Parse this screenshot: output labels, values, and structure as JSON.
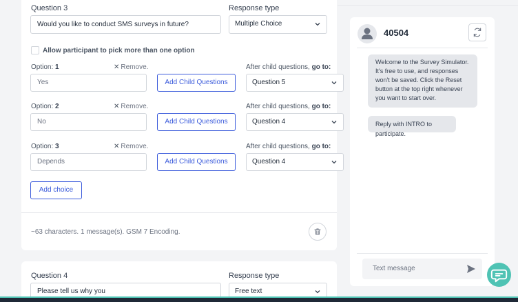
{
  "question3": {
    "label": "Question 3",
    "text": "Would you like to conduct SMS surveys in future?",
    "response_type_label": "Response type",
    "response_type": "Multiple Choice",
    "multi_option_label": "Allow participant to pick more than one option",
    "options": [
      {
        "prefix": "Option:",
        "num": "1",
        "remove": "Remove.",
        "placeholder": "Yes",
        "add_child": "Add Child Questions",
        "goto_label": "After child questions,",
        "goto_bold": "go to:",
        "goto": "Question 5"
      },
      {
        "prefix": "Option:",
        "num": "2",
        "remove": "Remove.",
        "placeholder": "No",
        "add_child": "Add Child Questions",
        "goto_label": "After child questions,",
        "goto_bold": "go to:",
        "goto": "Question 4"
      },
      {
        "prefix": "Option:",
        "num": "3",
        "remove": "Remove.",
        "placeholder": "Depends",
        "add_child": "Add Child Questions",
        "goto_label": "After child questions,",
        "goto_bold": "go to:",
        "goto": "Question 4"
      }
    ],
    "add_choice": "Add choice",
    "char_info": "~63 characters. 1 message(s). GSM 7 Encoding."
  },
  "question4": {
    "label": "Question 4",
    "text": "Please tell us why you",
    "response_type_label": "Response type",
    "response_type": "Free text"
  },
  "simulator": {
    "number": "40504",
    "messages": [
      "Welcome to the Survey Simulator. It's free to use, and responses won't be saved. Click the Reset button at the top right whenever you want to start over.",
      "Reply with INTRO to participate."
    ],
    "input_placeholder": "Text message"
  },
  "icons": {
    "remove": "x-icon",
    "select": "chevron-down-icon",
    "trash": "trash-icon",
    "avatar": "user-icon",
    "refresh": "refresh-icon",
    "send": "send-icon",
    "chat": "chat-bubble-icon"
  },
  "colors": {
    "primary": "#3b5bdb",
    "chat_fab": "#4fc3b4",
    "bubble": "#e5e7eb"
  }
}
